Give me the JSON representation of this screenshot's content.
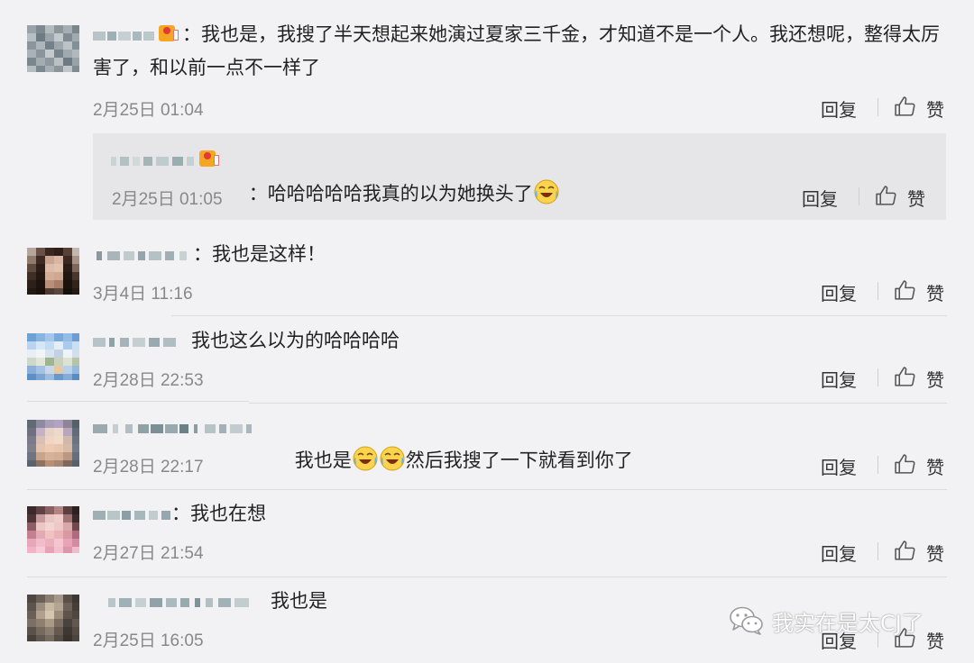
{
  "comments": [
    {
      "text": "：我也是，我搜了半天想起来她演过夏家三千金，才知道不是一个人。我还想呢，整得太厉害了，和以前一点不一样了",
      "time": "2月25日 01:04",
      "reply": "回复",
      "like": "赞"
    },
    {
      "text": "：我也是这样！",
      "time": "3月4日 11:16",
      "reply": "回复",
      "like": "赞"
    },
    {
      "text": "我也这么以为的哈哈哈哈",
      "time": "2月28日 22:53",
      "reply": "回复",
      "like": "赞"
    },
    {
      "text_a": "我也是",
      "text_b": "然后我搜了一下就看到你了",
      "time": "2月28日 22:17",
      "reply": "回复",
      "like": "赞"
    },
    {
      "text": "：我也在想",
      "time": "2月27日 21:54",
      "reply": "回复",
      "like": "赞"
    },
    {
      "text": "我也是",
      "time": "2月25日 16:05",
      "reply": "回复",
      "like": "赞"
    }
  ],
  "subreply": {
    "text": "：哈哈哈哈哈我真的以为她换头了",
    "time": "2月25日 01:05",
    "reply": "回复",
    "like": "赞"
  },
  "watermark": {
    "text": "我实在是太CJ了"
  },
  "colors": {
    "background": "#f2f2f4",
    "subreply_bg": "#e6e6e8",
    "meta_text": "#888888",
    "badge": "#f5a623"
  },
  "icons": [
    "thumbs-up-icon",
    "laugh-cry-emoji",
    "vip-badge-icon",
    "wechat-icon"
  ]
}
